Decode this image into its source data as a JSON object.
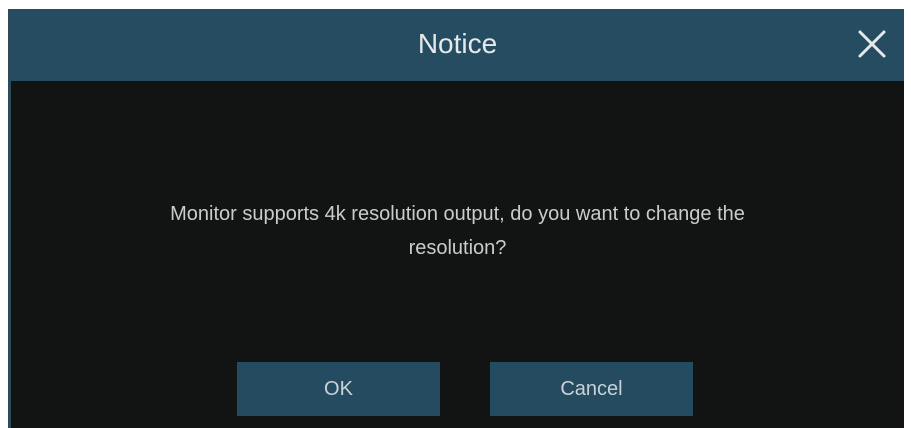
{
  "dialog": {
    "title": "Notice",
    "message_line1": "Monitor supports 4k resolution output, do you want to change the",
    "message_line2": "resolution?",
    "ok_label": "OK",
    "cancel_label": "Cancel",
    "close_icon": "close-icon"
  },
  "colors": {
    "titlebar": "#264c62",
    "background": "#111412",
    "button": "#244b60",
    "text": "#c9cccd"
  }
}
